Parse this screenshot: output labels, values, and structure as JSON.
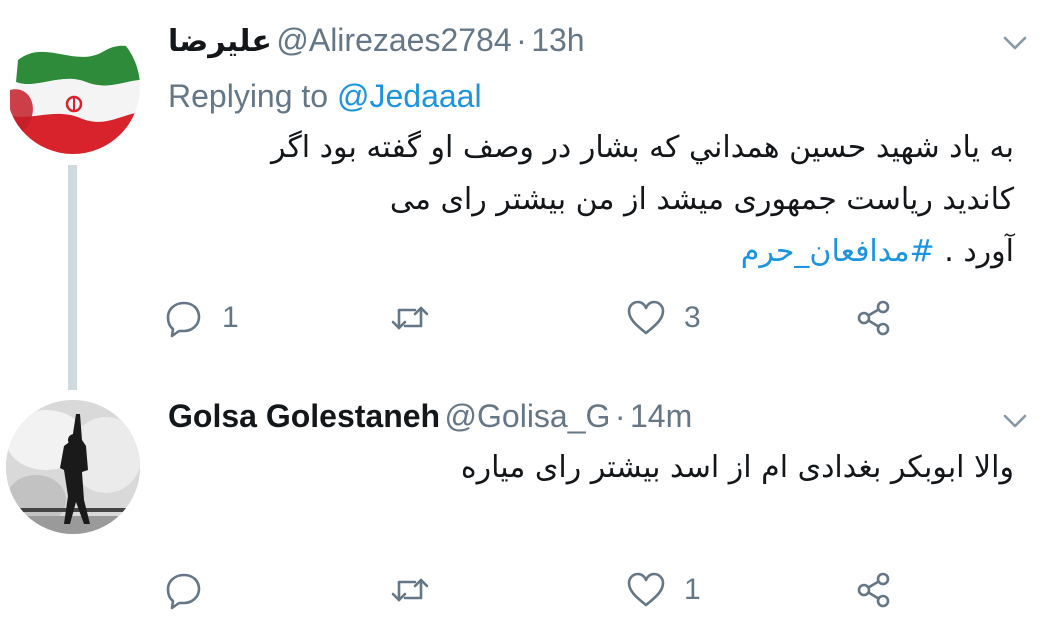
{
  "tweets": [
    {
      "display_name": "عليرضا",
      "handle": "@Alirezaes2784",
      "separator": "·",
      "time": "13h",
      "replying_prefix": "Replying to",
      "replying_to": "@Jedaaal",
      "body_lines": [
        "به ياد شهيد حسين همداني كه بشار در وصف او گفته بود اگر",
        "كانديد رياست جمهوری ميشد از من بيشتر رای می",
        "آورد ."
      ],
      "hashtag": "#مدافعان_حرم",
      "reply_count": "1",
      "retweet_count": "",
      "like_count": "3"
    },
    {
      "display_name": "Golsa Golestaneh",
      "handle": "@Golisa_G",
      "separator": "·",
      "time": "14m",
      "body_lines": [
        "والا ابوبکر بغدادی ام از اسد بیشتر رای میاره"
      ],
      "reply_count": "",
      "retweet_count": "",
      "like_count": "1"
    }
  ],
  "icons": {
    "reply": "reply-icon",
    "retweet": "retweet-icon",
    "like": "heart-icon",
    "share": "share-icon",
    "more": "chevron-down-icon"
  },
  "colors": {
    "text": "#14171a",
    "secondary": "#657786",
    "link": "#1b95e0",
    "thread_line": "#cfd9de"
  }
}
